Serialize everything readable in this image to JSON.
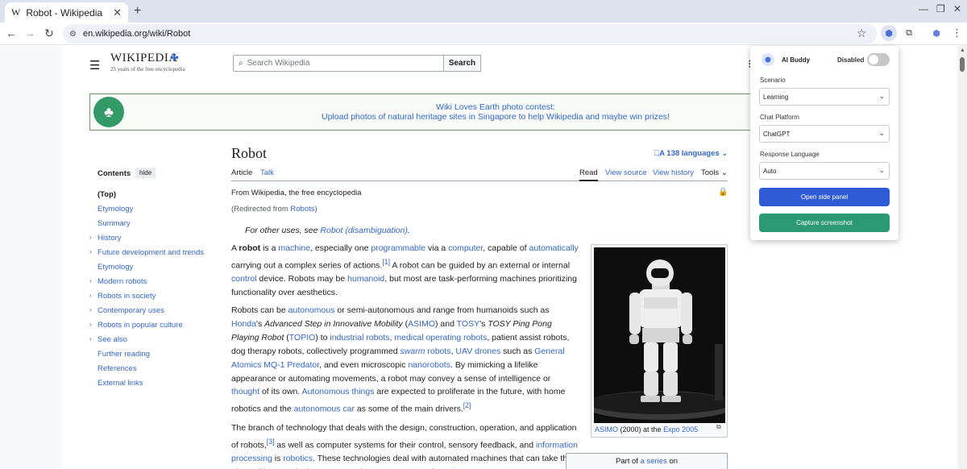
{
  "browser": {
    "tab_favicon": "W",
    "tab_title": "Robot - Wikipedia",
    "tab_close": "✕",
    "new_tab": "+",
    "url": "en.wikipedia.org/wiki/Robot",
    "win_minimize": "—",
    "win_restore": "❐",
    "win_close": "✕"
  },
  "wiki": {
    "wordmark": "WIKIPEDIA",
    "tagline": "25 years of the free encyclopedia",
    "search_placeholder": "Search Wikipedia",
    "search_button": "Search",
    "banner_line1": "Wiki Loves Earth photo contest:",
    "banner_line2": "Upload photos of natural heritage sites in Singapore to help Wikipedia and maybe win prizes!",
    "toc": {
      "title": "Contents",
      "hide": "hide",
      "items": [
        {
          "label": "(Top)"
        },
        {
          "label": "Etymology"
        },
        {
          "label": "Summary"
        },
        {
          "label": "History"
        },
        {
          "label": "Future development and trends"
        },
        {
          "label": "Etymology"
        },
        {
          "label": "Modern robots"
        },
        {
          "label": "Robots in society"
        },
        {
          "label": "Contemporary uses"
        },
        {
          "label": "Robots in popular culture"
        },
        {
          "label": "See also"
        },
        {
          "label": "Further reading"
        },
        {
          "label": "References"
        },
        {
          "label": "External links"
        }
      ]
    },
    "page_title": "Robot",
    "languages": "138 languages",
    "tabs": {
      "article": "Article",
      "talk": "Talk",
      "read": "Read",
      "view_source": "View source",
      "view_history": "View history",
      "tools": "Tools"
    },
    "from": "From Wikipedia, the free encyclopedia",
    "redirected_prefix": "(Redirected from ",
    "redirected_link": "Robots",
    "redirected_suffix": ")",
    "hatnote_prefix": "For other uses, see ",
    "hatnote_link": "Robot (disambiguation)",
    "hatnote_suffix": ".",
    "caption": {
      "link1": "ASIMO",
      "mid": " (2000) at the ",
      "link2": "Expo 2005"
    },
    "series_prefix": "Part of ",
    "series_link": "a series",
    "series_suffix": " on"
  },
  "extension": {
    "name": "AI Buddy",
    "status": "Disabled",
    "scenario_label": "Scenario",
    "scenario_value": "Learning",
    "platform_label": "Chat Platform",
    "platform_value": "ChatGPT",
    "language_label": "Response Language",
    "language_value": "Auto",
    "open_panel": "Open side panel",
    "capture": "Capture screenshot",
    "colors": {
      "primary": "#2f5bd6",
      "capture": "#2b9a74",
      "toggle_off": "#c7c7c7"
    }
  },
  "icons": {
    "menu": "☰",
    "search": "⌕",
    "lock": "🔒",
    "chevron": "⌄"
  }
}
